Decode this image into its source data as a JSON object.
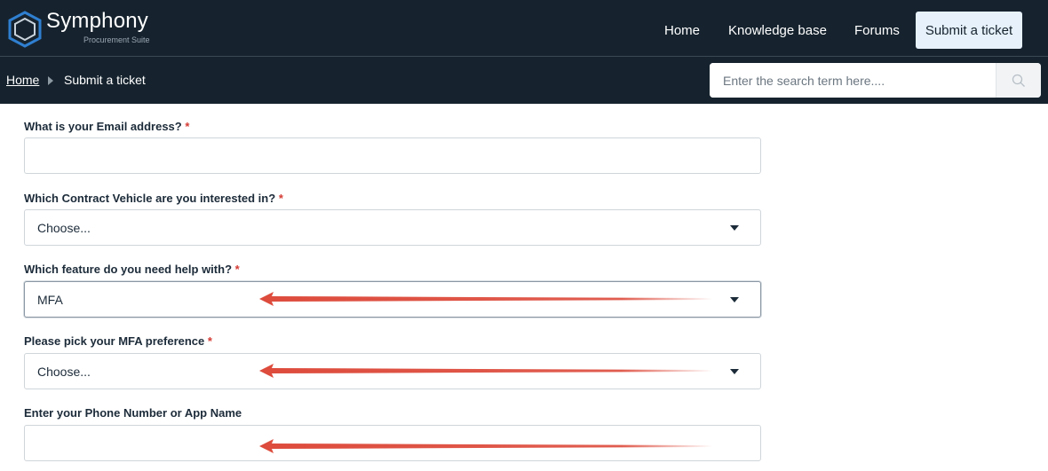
{
  "brand": {
    "name": "Symphony",
    "tagline": "Procurement Suite"
  },
  "nav": {
    "home": "Home",
    "knowledge_base": "Knowledge base",
    "forums": "Forums",
    "submit_ticket": "Submit a ticket"
  },
  "breadcrumb": {
    "home": "Home",
    "current": "Submit a ticket"
  },
  "search": {
    "placeholder": "Enter the search term here....",
    "icon": "search-icon"
  },
  "form": {
    "required_marker": "*",
    "email": {
      "label": "What is your Email address?",
      "value": ""
    },
    "contract_vehicle": {
      "label": "Which Contract Vehicle are you interested in?",
      "value": "Choose..."
    },
    "feature": {
      "label": "Which feature do you need help with?",
      "value": "MFA"
    },
    "mfa_preference": {
      "label": "Please pick your MFA preference",
      "value": "Choose..."
    },
    "phone_or_app": {
      "label": "Enter your Phone Number or App Name",
      "value": ""
    }
  },
  "colors": {
    "header_bg": "#16232e",
    "accent_button": "#e6f1fb",
    "required": "#d43b34",
    "annotation_arrow": "#dd4b3c"
  }
}
